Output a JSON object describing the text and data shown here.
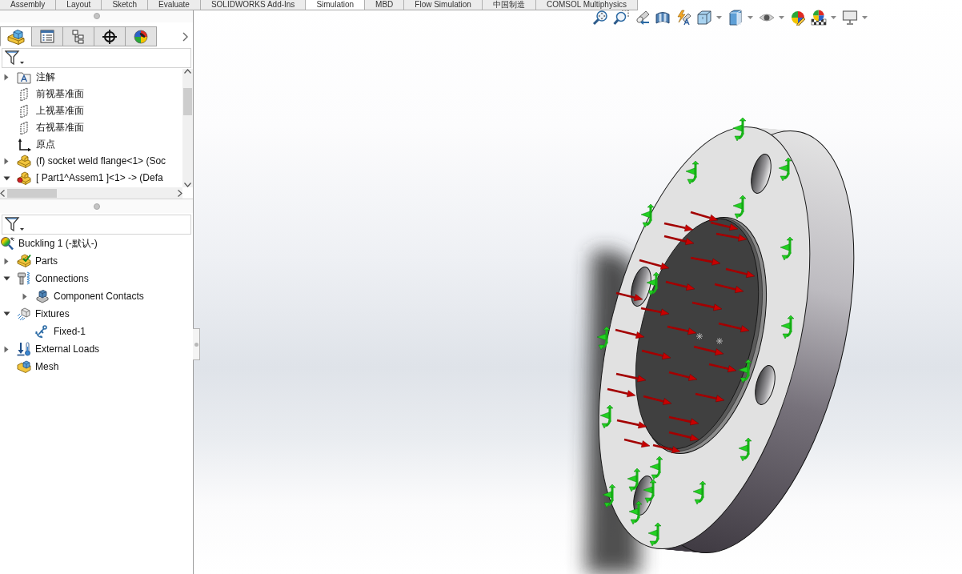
{
  "ribbon_tabs": [
    {
      "label": "Assembly",
      "selected": false
    },
    {
      "label": "Layout",
      "selected": false
    },
    {
      "label": "Sketch",
      "selected": false
    },
    {
      "label": "Evaluate",
      "selected": false
    },
    {
      "label": "SOLIDWORKS Add-Ins",
      "selected": false
    },
    {
      "label": "Simulation",
      "selected": true
    },
    {
      "label": "MBD",
      "selected": false
    },
    {
      "label": "Flow Simulation",
      "selected": false
    },
    {
      "label": "中国制造",
      "selected": false
    },
    {
      "label": "COMSOL Multiphysics",
      "selected": false
    }
  ],
  "feature_panel": {
    "tabs": [
      {
        "kind": "feature_manager",
        "selected": true
      },
      {
        "kind": "property_manager",
        "selected": false
      },
      {
        "kind": "configuration_manager",
        "selected": false
      },
      {
        "kind": "dimxpert",
        "selected": false
      },
      {
        "kind": "display_manager",
        "selected": false
      }
    ],
    "tree": [
      {
        "label": "注解",
        "kind": "annotations",
        "expanded": false
      },
      {
        "label": "前视基准面",
        "kind": "plane"
      },
      {
        "label": "上视基准面",
        "kind": "plane"
      },
      {
        "label": "右视基准面",
        "kind": "plane"
      },
      {
        "label": "原点",
        "kind": "origin"
      },
      {
        "label": "(f) socket weld flange<1> (Soc",
        "kind": "part",
        "expanded": false
      },
      {
        "label": "[ Part1^Assem1 ]<1> -> (Defa",
        "kind": "part_ref",
        "expanded": true
      }
    ]
  },
  "simulation_panel": {
    "tree": [
      {
        "label": "Buckling 1 (-默认-)",
        "kind": "study",
        "children": [
          {
            "label": "Parts",
            "kind": "parts",
            "expanded": false
          },
          {
            "label": "Connections",
            "kind": "connections",
            "expanded": true,
            "children": [
              {
                "label": "Component Contacts",
                "kind": "contacts",
                "expanded": false
              }
            ]
          },
          {
            "label": "Fixtures",
            "kind": "fixtures",
            "expanded": true,
            "children": [
              {
                "label": "Fixed-1",
                "kind": "fixed"
              }
            ]
          },
          {
            "label": "External Loads",
            "kind": "loads",
            "expanded": false
          },
          {
            "label": "Mesh",
            "kind": "mesh"
          }
        ]
      }
    ]
  }
}
